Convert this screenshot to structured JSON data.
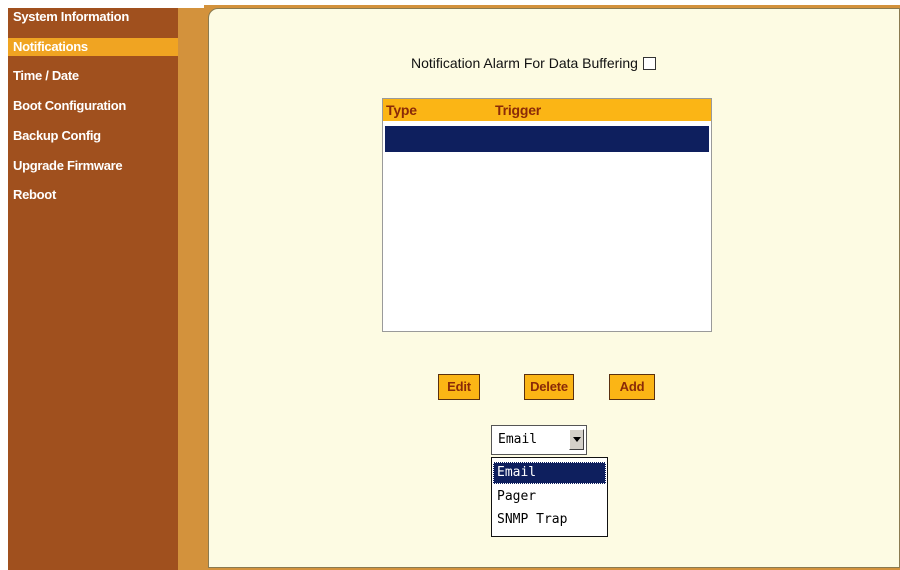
{
  "sidebar": {
    "items": [
      {
        "label": "System Information"
      },
      {
        "label": "Notifications"
      },
      {
        "label": "Time / Date"
      },
      {
        "label": "Boot Configuration"
      },
      {
        "label": "Backup Config"
      },
      {
        "label": "Upgrade Firmware"
      },
      {
        "label": "Reboot"
      }
    ],
    "active": "Notifications"
  },
  "main": {
    "alarm_label": "Notification Alarm For Data Buffering",
    "alarm_checked": false,
    "table": {
      "columns": [
        "Type",
        "Trigger"
      ],
      "rows": []
    },
    "buttons": {
      "edit": "Edit",
      "delete": "Delete",
      "add": "Add"
    },
    "type_select": {
      "value": "Email",
      "options": [
        "Email",
        "Pager",
        "SNMP Trap"
      ],
      "highlighted": "Email"
    }
  },
  "colors": {
    "sidebar_bg": "#a0501e",
    "accent_orange": "#fbb515",
    "selection_navy": "#0e1f5e",
    "panel_bg": "#fdfbe3"
  }
}
